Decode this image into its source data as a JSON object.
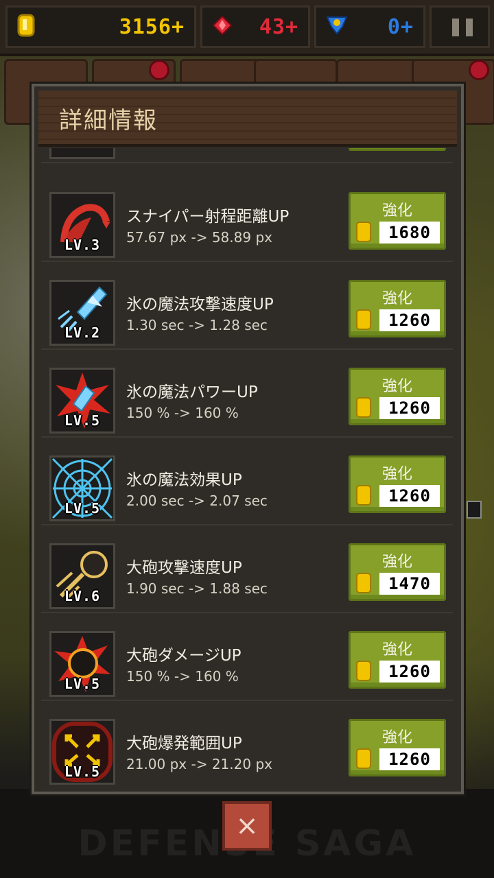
{
  "resources": {
    "gold": {
      "value": "3156",
      "plus": "+",
      "color": "#f2c400"
    },
    "gem": {
      "value": "43",
      "plus": "+",
      "color": "#e02a3a"
    },
    "medal": {
      "value": "0",
      "plus": "+",
      "color": "#2a7ae0"
    }
  },
  "dialog": {
    "title": "詳細情報",
    "upgrade_label": "強化"
  },
  "items": [
    {
      "icon": "sniper-range-icon",
      "level": "LV.3",
      "name": "スナイパー射程距離UP",
      "detail": "57.67 px -> 58.89 px",
      "cost": "1680"
    },
    {
      "icon": "ice-magic-speed-icon",
      "level": "LV.2",
      "name": "氷の魔法攻撃速度UP",
      "detail": "1.30 sec -> 1.28 sec",
      "cost": "1260"
    },
    {
      "icon": "ice-magic-power-icon",
      "level": "LV.5",
      "name": "氷の魔法パワーUP",
      "detail": "150 % -> 160 %",
      "cost": "1260"
    },
    {
      "icon": "ice-magic-effect-icon",
      "level": "LV.5",
      "name": "氷の魔法効果UP",
      "detail": "2.00 sec -> 2.07 sec",
      "cost": "1260"
    },
    {
      "icon": "cannon-speed-icon",
      "level": "LV.6",
      "name": "大砲攻撃速度UP",
      "detail": "1.90 sec -> 1.88 sec",
      "cost": "1470"
    },
    {
      "icon": "cannon-damage-icon",
      "level": "LV.5",
      "name": "大砲ダメージUP",
      "detail": "150 % -> 160 %",
      "cost": "1260"
    },
    {
      "icon": "cannon-blast-range-icon",
      "level": "LV.5",
      "name": "大砲爆発範囲UP",
      "detail": "21.00 px -> 21.20 px",
      "cost": "1260"
    }
  ],
  "close_label": "×",
  "background_logo": "DEFENSE SAGA"
}
